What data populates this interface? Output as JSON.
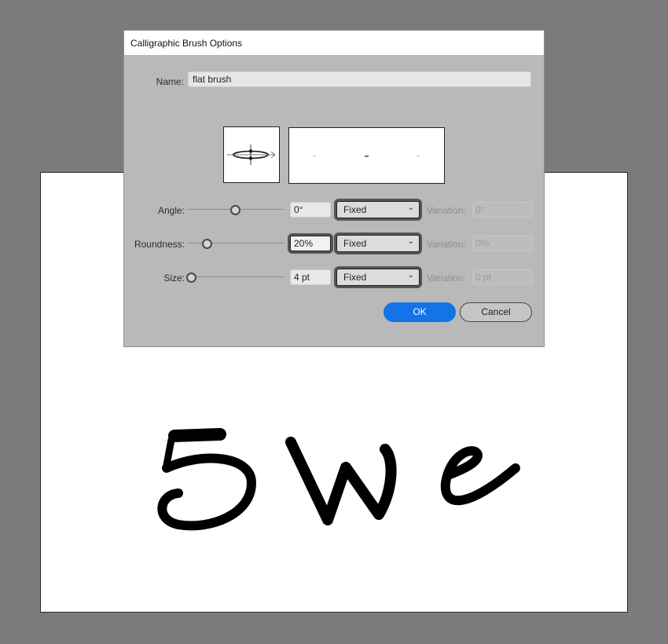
{
  "dialog": {
    "title": "Calligraphic Brush Options",
    "name_label": "Name:",
    "name_value": "flat brush",
    "ok_label": "OK",
    "cancel_label": "Cancel"
  },
  "rows": [
    {
      "label": "Angle:",
      "slider_fraction": 0.49,
      "value": "0°",
      "mode": "Fixed",
      "variation_label": "Variation:",
      "variation_value": "0°"
    },
    {
      "label": "Roundness:",
      "slider_fraction": 0.2,
      "value": "20%",
      "mode": "Fixed",
      "variation_label": "Variation:",
      "variation_value": "0%"
    },
    {
      "label": "Size:",
      "slider_fraction": 0.03,
      "value": "4 pt",
      "mode": "Fixed",
      "variation_label": "Variation:",
      "variation_value": "0 pt"
    }
  ],
  "colors": {
    "accent": "#1473e6",
    "dialog_bg": "#b9b9b9",
    "canvas_bg": "#7b7b7b",
    "artboard": "#ffffff"
  },
  "icons": {
    "brush_shape": "brush-shape-preview-icon",
    "dropdown": "chevron-down-icon",
    "stepper": "chevron-right-icon"
  },
  "artwork": {
    "glyphs": [
      "5",
      "W",
      "e"
    ]
  }
}
